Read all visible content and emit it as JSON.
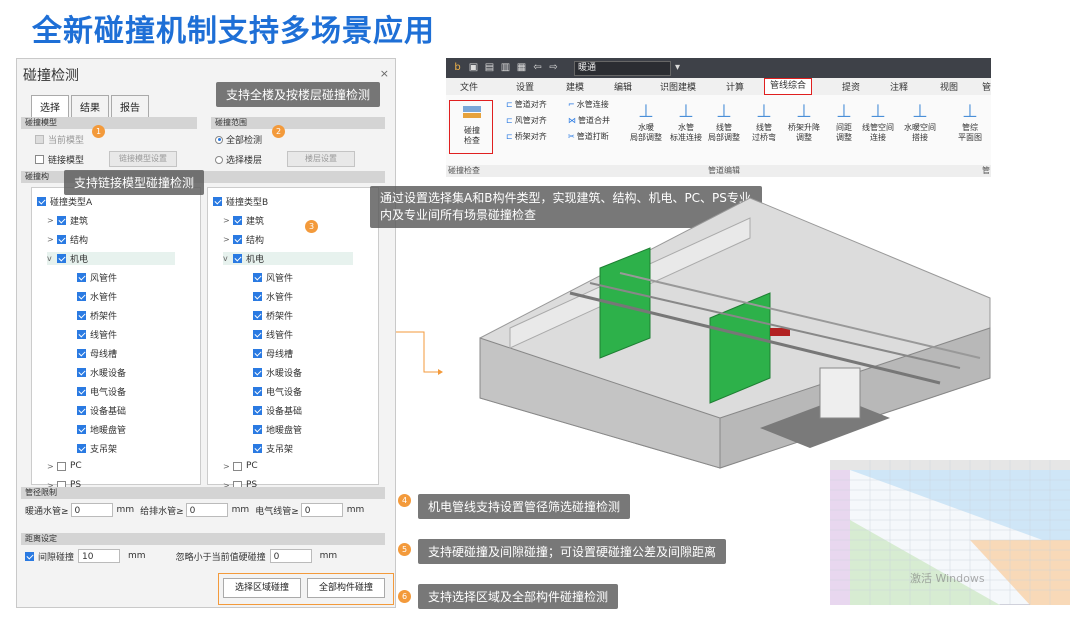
{
  "page_title": "全新碰撞机制支持多场景应用",
  "dialog": {
    "title": "碰撞检测",
    "close": "×",
    "tabs": [
      "选择",
      "结果",
      "报告"
    ],
    "model_section": "碰撞模型",
    "range_section": "碰撞范围",
    "current_model": "当前模型",
    "link_model": "链接模型",
    "link_model_btn": "链接模型设置",
    "all_check": "全部检测",
    "select_floor": "选择楼层",
    "floor_btn": "楼层设置",
    "component_section": "碰撞构",
    "type_a": "碰撞类型A",
    "type_b": "碰撞类型B",
    "tree_a": [
      "建筑",
      "结构",
      "机电",
      "风管件",
      "水管件",
      "桥架件",
      "线管件",
      "母线槽",
      "水暖设备",
      "电气设备",
      "设备基础",
      "地暖盘管",
      "支吊架",
      "PC",
      "PS"
    ],
    "tree_b": [
      "建筑",
      "结构",
      "机电",
      "风管件",
      "水管件",
      "桥架件",
      "线管件",
      "母线槽",
      "水暖设备",
      "电气设备",
      "设备基础",
      "地暖盘管",
      "支吊架",
      "PC",
      "PS"
    ],
    "pipe_section": "管径限制",
    "hv_pipe": "暖通水管≥",
    "hv_val": "0",
    "drain_pipe": "给排水管≥",
    "drain_val": "0",
    "elec_pipe": "电气线管≥",
    "elec_val": "0",
    "unit": "mm",
    "dist_section": "距离设定",
    "gap_label": "间隙碰撞",
    "gap_val": "10",
    "ignore_label": "忽略小于当前值硬碰撞",
    "ignore_val": "0",
    "btn_area": "选择区域碰撞",
    "btn_all": "全部构件碰撞"
  },
  "callouts": {
    "c1": "支持全楼及按楼层碰撞检测",
    "c2": "支持链接模型碰撞检测",
    "c3": "通过设置选择集A和B构件类型，实现建筑、结构、机电、PC、PS专业内及专业间所有场景碰撞检查",
    "c4": "机电管线支持设置管径筛选碰撞检测",
    "c5": "支持硬碰撞及间隙碰撞；可设置硬碰撞公差及间隙距离",
    "c6": "支持选择区域及全部构件碰撞检测"
  },
  "badges": [
    "1",
    "2",
    "3",
    "4",
    "5",
    "6"
  ],
  "ribbon": {
    "field": "暖通",
    "menus": [
      "文件",
      "设置",
      "建模",
      "编辑",
      "识图建模",
      "计算",
      "管线综合",
      "提资",
      "注释",
      "视图",
      "管"
    ],
    "collision_btn": "碰撞\n检查",
    "small": [
      "管道对齐",
      "水管连接",
      "风管对齐",
      "管道合并",
      "桥架对齐",
      "管道打断"
    ],
    "big": [
      "水暖\n局部调整",
      "水管\n标准连接",
      "线管\n局部调整",
      "线管\n过桥弯",
      "桥架升降\n调整",
      "间距\n调整",
      "线管空间\n连接",
      "水暖空间\n搭接",
      "管综\n平面图"
    ],
    "group1": "碰撞检查",
    "group2": "管道编辑",
    "group3": "管"
  },
  "watermark": "激活 Windows",
  "colors": {
    "title": "#1e6fd6",
    "accent": "#f39a3b",
    "red": "#e02020",
    "check": "#2a7ae2"
  }
}
